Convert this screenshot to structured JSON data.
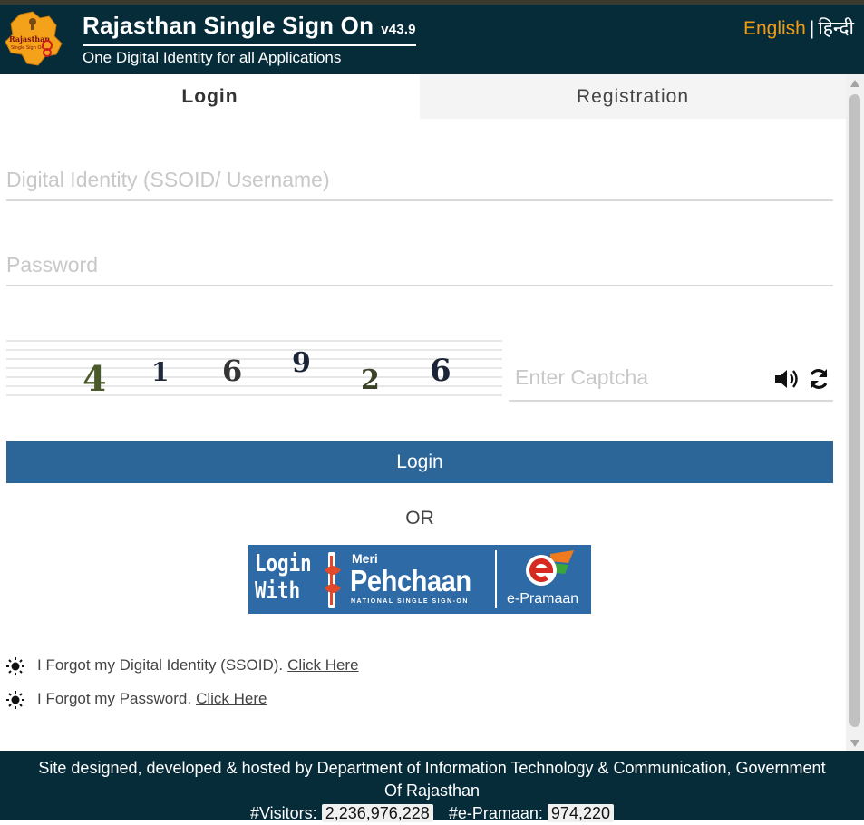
{
  "header": {
    "title": "Rajasthan Single Sign On",
    "version": "v43.9",
    "subtitle": "One Digital Identity for all Applications",
    "lang_en": "English",
    "lang_sep": "|",
    "lang_hi": "हिन्दी"
  },
  "tabs": {
    "login": "Login",
    "registration": "Registration"
  },
  "form": {
    "username_placeholder": "Digital Identity (SSOID/ Username)",
    "password_placeholder": "Password",
    "captcha_digits": [
      "4",
      "1",
      "6",
      "9",
      "2",
      "6"
    ],
    "captcha_placeholder": "Enter Captcha",
    "login_button": "Login",
    "or_text": "OR"
  },
  "meri_pehchaan": {
    "login_line1": "Login",
    "login_line2": "With",
    "meri": "Meri",
    "pehchaan": "Pehchaan",
    "nsso": "NATIONAL SINGLE SIGN-ON",
    "epramaan": "e-Pramaan"
  },
  "links": {
    "forgot_ssoid_text": "I Forgot my Digital Identity (SSOID).",
    "forgot_ssoid_link": "Click Here",
    "forgot_password_text": "I Forgot my Password.",
    "forgot_password_link": "Click Here"
  },
  "footer": {
    "line1": "Site designed, developed & hosted by Department of Information Technology & Communication, Government",
    "line2": "Of Rajasthan",
    "visitors_label": "#Visitors:",
    "visitors_value": "2,236,976,228",
    "epramaan_label": "#e-Pramaan:",
    "epramaan_value": "974,220"
  },
  "colors": {
    "header_bg": "#062c3a",
    "accent_orange": "#f39c12",
    "login_button": "#2c6699",
    "meri_pehchaan_bg": "#2e6aa6"
  }
}
